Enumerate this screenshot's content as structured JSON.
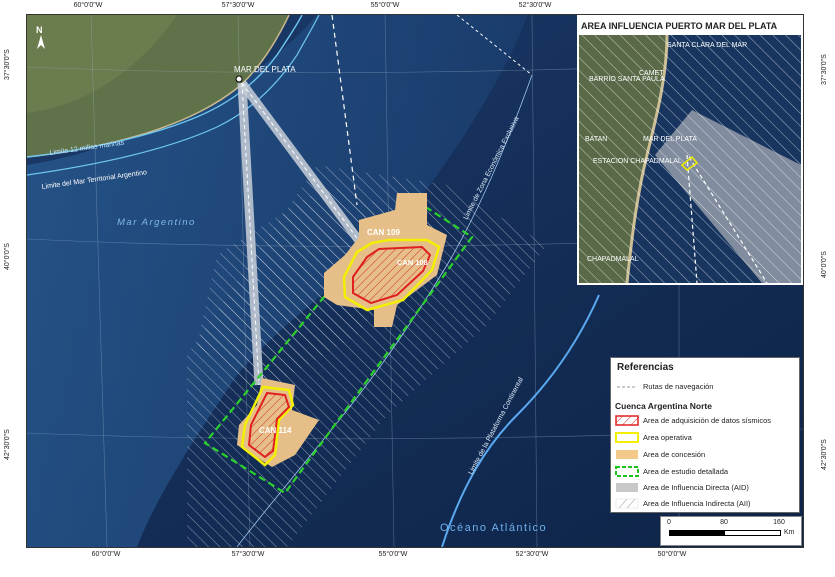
{
  "graticule": {
    "top": [
      "60°0'0\"W",
      "57°30'0\"W",
      "55°0'0\"W",
      "52°30'0\"W"
    ],
    "bottom": [
      "60°0'0\"W",
      "57°30'0\"W",
      "55°0'0\"W",
      "52°30'0\"W",
      "50°0'0\"W"
    ],
    "left": [
      "37°30'0\"S",
      "40°0'0\"S",
      "42°30'0\"S"
    ],
    "right": [
      "37°30'0\"S",
      "40°0'0\"S",
      "42°30'0\"S"
    ]
  },
  "map_labels": {
    "city": "MAR DEL PLATA",
    "limit_12_miles": "Limite 12 millas marinas",
    "limit_territorial": "Limite del Mar Territorial Argentino",
    "sea": "Mar Argentino",
    "eez": "Limite de Zona Económica Exclusiva",
    "shelf": "Limite de la Plataforma Continental",
    "ocean": "Océano Atlántico",
    "block_109": "CAN 109",
    "block_108": "CAN 108",
    "block_114": "CAN 114"
  },
  "inset": {
    "title": "AREA INFLUENCIA PUERTO MAR DEL PLATA",
    "places": [
      "SANTA CLARA DEL MAR",
      "CAMET",
      "BARRIO SANTA PAULA",
      "BATAN",
      "MAR DEL PLATA",
      "ESTACION CHAPADMALAL",
      "CHAPADMALAL"
    ]
  },
  "legend": {
    "title": "Referencias",
    "route_label": "Rutas de navegación",
    "section": "Cuenca Argentina Norte",
    "items": [
      {
        "label": "Area de adquisición de datos sísmicos",
        "color": "#e02020"
      },
      {
        "label": "Area operativa",
        "color": "#f2f000"
      },
      {
        "label": "Area de concesión",
        "color": "#f3c98b"
      },
      {
        "label": "Area de estudio detallada",
        "color": "#1ec21e"
      },
      {
        "label": "Area de Influencia Directa (AID)",
        "color": "#c8c8c8"
      },
      {
        "label": "Area de Influencia Indirecta (AII)",
        "color": "#ffffff"
      }
    ]
  },
  "scale": {
    "ticks": [
      "0",
      "80",
      "160"
    ],
    "unit": "Km"
  },
  "north_arrow": "N",
  "colors": {
    "ocean": "#14305c",
    "land": "#5d6e45",
    "shelf": "#2f6aa0",
    "concession": "#e6bf88"
  }
}
